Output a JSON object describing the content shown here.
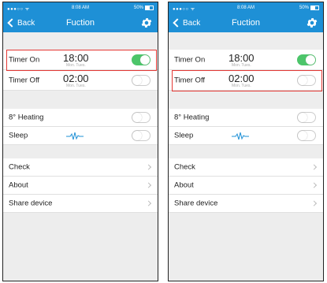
{
  "status_bar": {
    "signal": "●●●○○ ᯤ",
    "time": "8:08 AM",
    "battery": "50%"
  },
  "nav": {
    "back_label": "Back",
    "title": "Fuction"
  },
  "timer_on": {
    "label": "Timer On",
    "time": "18:00",
    "days": "Mon. Tues."
  },
  "timer_off": {
    "label": "Timer Off",
    "time": "02:00",
    "days": "Mon. Tues."
  },
  "heating": {
    "label": "8° Heating"
  },
  "sleep": {
    "label": "Sleep"
  },
  "menu": {
    "check": "Check",
    "about": "About",
    "share": "Share device"
  },
  "colors": {
    "header": "#1e90d6",
    "toggle_on": "#4cc56a",
    "highlight": "#e53935"
  },
  "screens": [
    {
      "timer_on": true,
      "timer_off": false,
      "heating": false,
      "sleep": false,
      "highlighted": "timer-on"
    },
    {
      "timer_on": true,
      "timer_off": false,
      "heating": false,
      "sleep": false,
      "highlighted": "timer-off"
    }
  ]
}
